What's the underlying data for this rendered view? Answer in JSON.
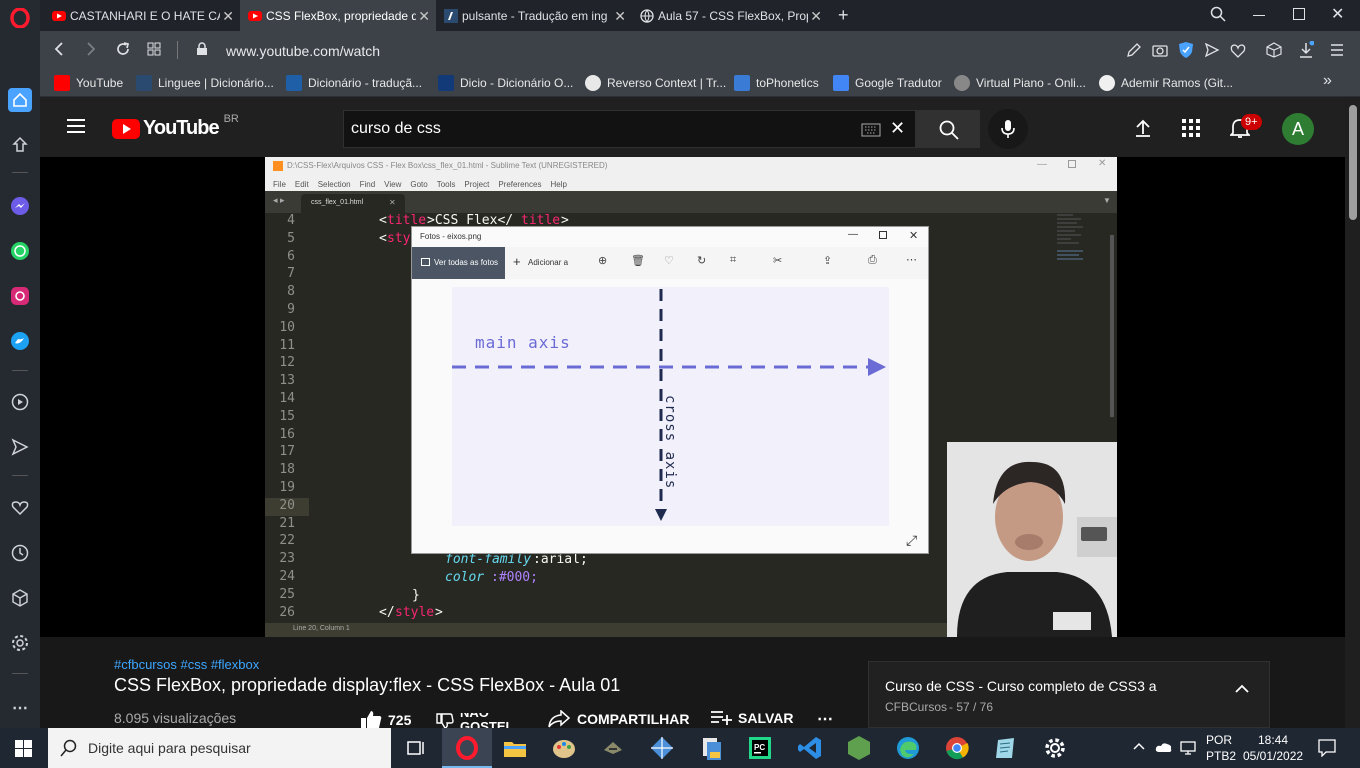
{
  "browser": {
    "tabs": [
      {
        "title": "CASTANHARI E O HATE CA",
        "active": false
      },
      {
        "title": "CSS FlexBox, propriedade d",
        "active": true
      },
      {
        "title": "pulsante - Tradução em ing",
        "active": false
      },
      {
        "title": "Aula 57 - CSS FlexBox, Prop",
        "active": false
      }
    ],
    "url": "www.youtube.com/watch",
    "bookmarks": [
      "YouTube",
      "Linguee | Dicionário...",
      "Dicionário - traduçã...",
      "Dicio - Dicionário O...",
      "Reverso Context | Tr...",
      "toPhonetics",
      "Google Tradutor",
      "Virtual Piano - Onli...",
      "Ademir Ramos (Git..."
    ]
  },
  "youtube": {
    "logo_text": "YouTube",
    "country": "BR",
    "search_value": "curso de css",
    "notifications": "9+",
    "avatar_letter": "A"
  },
  "video": {
    "sublime_title": "D:\\CSS-Flex\\Arquivos CSS - Flex Box\\css_flex_01.html - Sublime Text (UNREGISTERED)",
    "sublime_menu": [
      "File",
      "Edit",
      "Selection",
      "Find",
      "View",
      "Goto",
      "Tools",
      "Project",
      "Preferences",
      "Help"
    ],
    "file_tab": "css_flex_01.html",
    "line_numbers": [
      "4",
      "5",
      "6",
      "7",
      "8",
      "9",
      "10",
      "11",
      "12",
      "13",
      "14",
      "15",
      "16",
      "17",
      "18",
      "19",
      "20",
      "21",
      "22",
      "23",
      "24",
      "25",
      "26"
    ],
    "status_text": "Line 20, Column 1",
    "photos_title": "Fotos - eixos.png",
    "photos_see_all": "Ver todas as fotos",
    "photos_add": "Adicionar a",
    "main_axis_label": "main axis",
    "cross_axis_label": "cross axis",
    "code": {
      "l4_open": "<",
      "l4_tag": "title",
      "l4_text": ">CSS Flex</",
      "l4_tag2": "title",
      "l4_close": ">",
      "l5_open": "<",
      "l5_tag": "sty",
      "l23_prop": "font-family",
      "l23_val": ":arial;",
      "l24_prop": "color",
      "l24_val": ":#000;",
      "l25": "}",
      "l26_open": "</",
      "l26_tag": "style",
      "l26_close": ">"
    }
  },
  "below": {
    "hashtags": "#cfbcursos #css #flexbox",
    "title": "CSS FlexBox, propriedade display:flex - CSS FlexBox - Aula 01",
    "views": "8.095 visualizações",
    "likes": "725",
    "dislike_label": "NÃO GOSTEI",
    "share_label": "COMPARTILHAR",
    "save_label": "SALVAR",
    "playlist_title": "Curso de CSS - Curso completo de CSS3 a",
    "playlist_channel": "CFBCursos",
    "playlist_progress": "- 57 / 76"
  },
  "taskbar": {
    "search_placeholder": "Digite aqui para pesquisar",
    "lang": "POR",
    "layout": "PTB2",
    "time": "18:44",
    "date": "05/01/2022"
  },
  "colors": {
    "youtube_red": "#ff0000",
    "axis_blue": "#6b6bd6",
    "cross_navy": "#1f2a4f",
    "avatar_green": "#2e7d32"
  }
}
